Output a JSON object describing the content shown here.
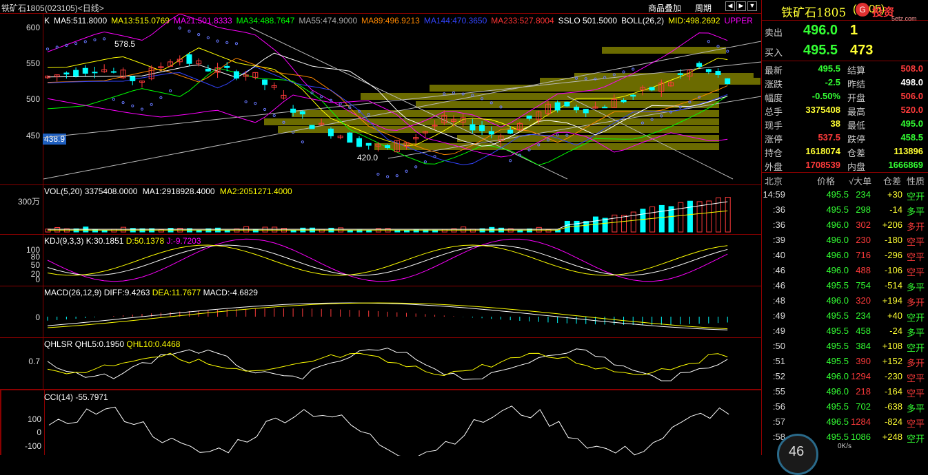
{
  "window": {
    "title": "铁矿石1805(023105)<日线>",
    "menu_overlay": "商品叠加",
    "menu_period": "周期"
  },
  "main_pane": {
    "indicators": [
      {
        "text": "K",
        "color": "#ffffff"
      },
      {
        "text": "MA5:511.8000",
        "color": "#ffffff"
      },
      {
        "text": "MA13:515.0769",
        "color": "#ffff00"
      },
      {
        "text": "MA21:501.8333",
        "color": "#ff00ff"
      },
      {
        "text": "MA34:488.7647",
        "color": "#00ff00"
      },
      {
        "text": "MA55:474.9000",
        "color": "#aaaaaa"
      },
      {
        "text": "MA89:496.9213",
        "color": "#ff8800"
      },
      {
        "text": "MA144:470.3650",
        "color": "#3344ff"
      },
      {
        "text": "MA233:527.8004",
        "color": "#ff3333"
      },
      {
        "text": "SSLO 501.5000",
        "color": "#ffffff"
      },
      {
        "text": "BOLL(26,2)",
        "color": "#ffffff"
      },
      {
        "text": "MID:498.2692",
        "color": "#ffff00"
      },
      {
        "text": "UPPER",
        "color": "#ff00ff"
      }
    ],
    "y_ticks": [
      "600",
      "550",
      "500",
      "450"
    ],
    "high_label": "578.5",
    "low_label": "420.0",
    "price_box": "438.9"
  },
  "vol_pane": {
    "header": "VOL(5,20) 3375408.0000",
    "ma1": "MA1:2918928.4000",
    "ma2": "MA2:2051271.4000",
    "y_tick": "300万"
  },
  "kdj_pane": {
    "header": "KDJ(9,3,3)",
    "k": "K:30.1851",
    "d": "D:50.1378",
    "j": "J:-9.7203",
    "y_ticks": [
      "100",
      "80",
      "50",
      "20",
      "0"
    ]
  },
  "macd_pane": {
    "header": "MACD(26,12,9)",
    "diff": "DIFF:9.4263",
    "dea": "DEA:11.7677",
    "macd": "MACD:-4.6829",
    "y_tick": "0"
  },
  "qhlsr_pane": {
    "header": "QHLSR",
    "ql5": "QHL5:0.1950",
    "ql10": "QHL10:0.4468",
    "y_tick": "0.7"
  },
  "cci_pane": {
    "header": "CCI(14) -55.7971",
    "y_ticks": [
      "100",
      "0",
      "-100"
    ]
  },
  "quote": {
    "title": "铁矿石1805",
    "code": "(1805)",
    "logo": "投资",
    "logo_url": "5etz.com",
    "sell_label": "卖出",
    "sell_price": "496.0",
    "sell_vol": "1",
    "buy_label": "买入",
    "buy_price": "495.5",
    "buy_vol": "473",
    "stats": [
      {
        "l1": "最新",
        "v1": "495.5",
        "c1": "green",
        "l2": "结算",
        "v2": "508.0",
        "c2": "red"
      },
      {
        "l1": "涨跌",
        "v1": "-2.5",
        "c1": "green",
        "l2": "昨结",
        "v2": "498.0",
        "c2": "white"
      },
      {
        "l1": "幅度",
        "v1": "-0.50%",
        "c1": "green",
        "l2": "开盘",
        "v2": "506.0",
        "c2": "red"
      },
      {
        "l1": "总手",
        "v1": "3375408",
        "c1": "yellow",
        "l2": "最高",
        "v2": "520.0",
        "c2": "red"
      },
      {
        "l1": "现手",
        "v1": "38",
        "c1": "yellow",
        "l2": "最低",
        "v2": "495.0",
        "c2": "green"
      },
      {
        "l1": "涨停",
        "v1": "537.5",
        "c1": "red",
        "l2": "跌停",
        "v2": "458.5",
        "c2": "green"
      },
      {
        "l1": "持仓",
        "v1": "1618074",
        "c1": "yellow",
        "l2": "仓差",
        "v2": "113896",
        "c2": "yellow"
      },
      {
        "l1": "外盘",
        "v1": "1708539",
        "c1": "red",
        "l2": "内盘",
        "v2": "1666869",
        "c2": "green"
      }
    ],
    "tick_header": {
      "place": "北京",
      "price": "价格",
      "vol": "√大单",
      "diff": "仓差",
      "nature": "性质"
    },
    "ticks": [
      {
        "t": "14:59",
        "p": "495.5",
        "v": "234",
        "d": "+30",
        "n": "空开",
        "pc": "green",
        "vc": "green",
        "dc": "yellow",
        "nc": "green"
      },
      {
        "t": ":36",
        "p": "495.5",
        "v": "298",
        "d": "-14",
        "n": "多平",
        "pc": "green",
        "vc": "green",
        "dc": "yellow",
        "nc": "green"
      },
      {
        "t": ":36",
        "p": "496.0",
        "v": "302",
        "d": "+206",
        "n": "多开",
        "pc": "green",
        "vc": "red",
        "dc": "yellow",
        "nc": "red"
      },
      {
        "t": ":39",
        "p": "496.0",
        "v": "230",
        "d": "-180",
        "n": "空平",
        "pc": "green",
        "vc": "red",
        "dc": "yellow",
        "nc": "red"
      },
      {
        "t": ":40",
        "p": "496.0",
        "v": "716",
        "d": "-296",
        "n": "空平",
        "pc": "green",
        "vc": "red",
        "dc": "yellow",
        "nc": "red"
      },
      {
        "t": ":46",
        "p": "496.0",
        "v": "488",
        "d": "-106",
        "n": "空平",
        "pc": "green",
        "vc": "red",
        "dc": "yellow",
        "nc": "red"
      },
      {
        "t": ":46",
        "p": "495.5",
        "v": "754",
        "d": "-514",
        "n": "多平",
        "pc": "green",
        "vc": "green",
        "dc": "yellow",
        "nc": "green"
      },
      {
        "t": ":48",
        "p": "496.0",
        "v": "320",
        "d": "+194",
        "n": "多开",
        "pc": "green",
        "vc": "red",
        "dc": "yellow",
        "nc": "red"
      },
      {
        "t": ":49",
        "p": "495.5",
        "v": "234",
        "d": "+40",
        "n": "空开",
        "pc": "green",
        "vc": "green",
        "dc": "yellow",
        "nc": "green"
      },
      {
        "t": ":49",
        "p": "495.5",
        "v": "458",
        "d": "-24",
        "n": "多平",
        "pc": "green",
        "vc": "green",
        "dc": "yellow",
        "nc": "green"
      },
      {
        "t": ":50",
        "p": "495.5",
        "v": "384",
        "d": "+108",
        "n": "空开",
        "pc": "green",
        "vc": "green",
        "dc": "yellow",
        "nc": "green"
      },
      {
        "t": ":51",
        "p": "495.5",
        "v": "390",
        "d": "+152",
        "n": "多开",
        "pc": "green",
        "vc": "red",
        "dc": "yellow",
        "nc": "red"
      },
      {
        "t": ":52",
        "p": "496.0",
        "v": "1294",
        "d": "-230",
        "n": "空平",
        "pc": "green",
        "vc": "red",
        "dc": "yellow",
        "nc": "red"
      },
      {
        "t": ":55",
        "p": "496.0",
        "v": "218",
        "d": "-164",
        "n": "空平",
        "pc": "green",
        "vc": "red",
        "dc": "yellow",
        "nc": "red"
      },
      {
        "t": ":56",
        "p": "495.5",
        "v": "702",
        "d": "-638",
        "n": "多平",
        "pc": "green",
        "vc": "green",
        "dc": "yellow",
        "nc": "green"
      },
      {
        "t": ":57",
        "p": "496.5",
        "v": "1284",
        "d": "-824",
        "n": "空平",
        "pc": "green",
        "vc": "red",
        "dc": "yellow",
        "nc": "red"
      },
      {
        "t": ":58",
        "p": "495.5",
        "v": "1086",
        "d": "+248",
        "n": "空开",
        "pc": "green",
        "vc": "green",
        "dc": "yellow",
        "nc": "green"
      }
    ],
    "speed_value": "46",
    "speed_unit": "0K/s"
  },
  "colors": {
    "up": "#ff3b3b",
    "down": "#00ffff",
    "grid": "#8b0000",
    "volume_band": "#6b6b00"
  }
}
